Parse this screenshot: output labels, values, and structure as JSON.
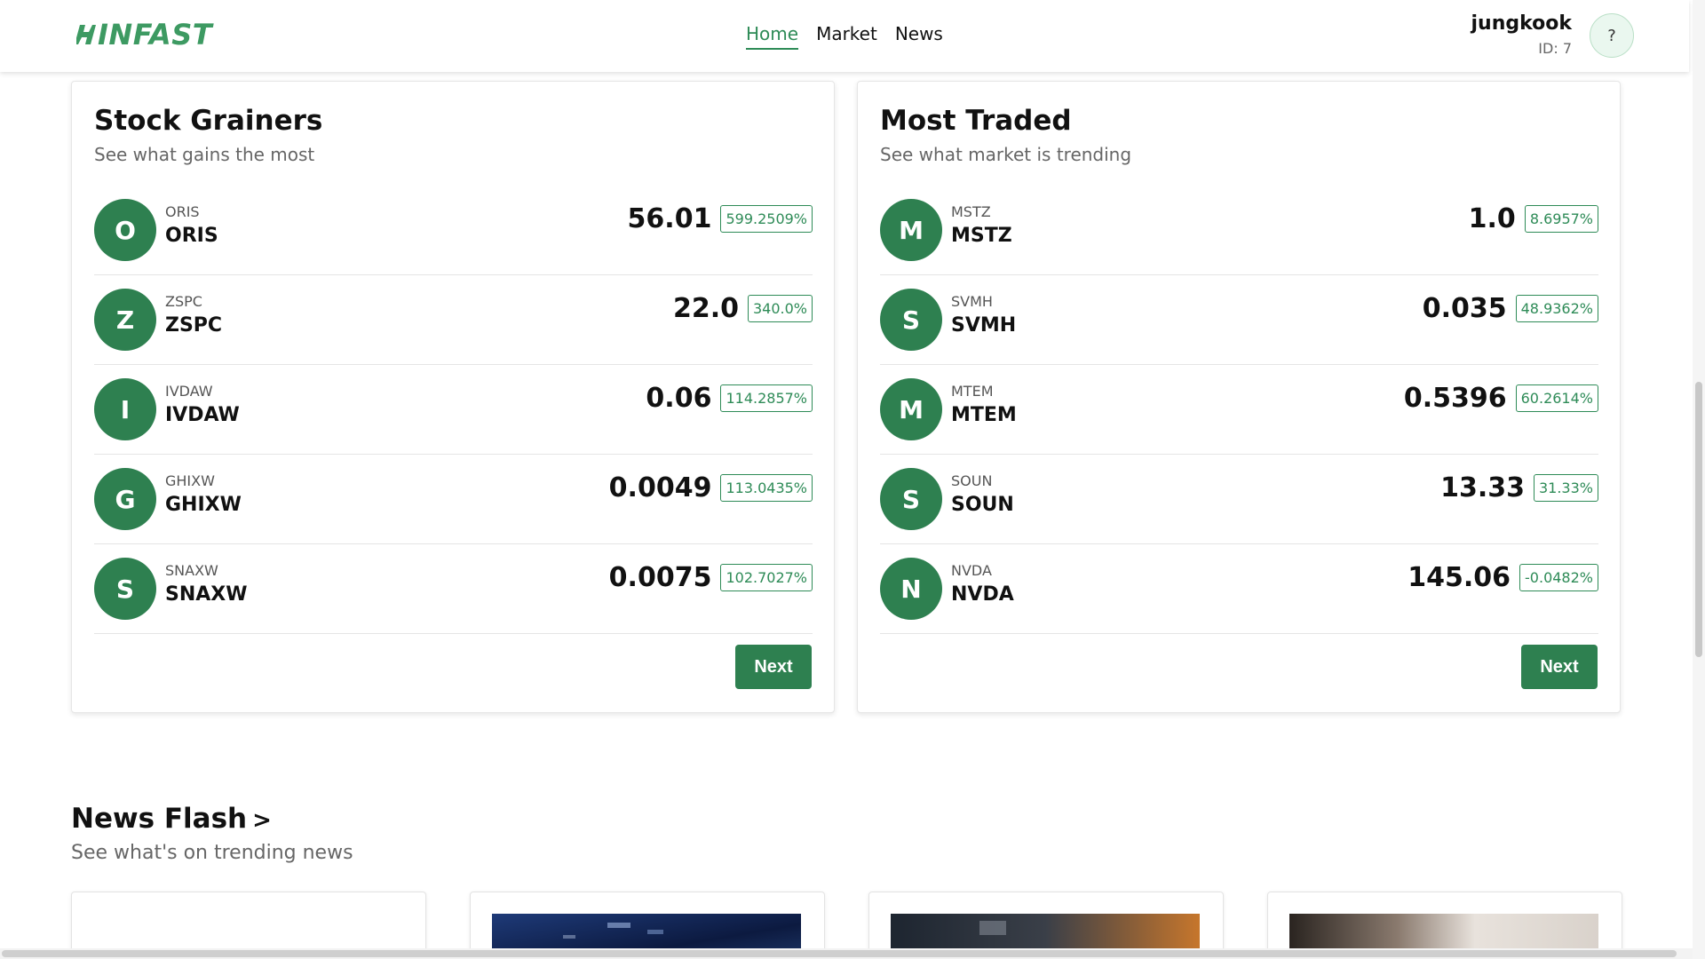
{
  "brand": {
    "name": "INFAST",
    "accent": "#2e8b57",
    "avatar_color": "#2e8050"
  },
  "nav": {
    "items": [
      {
        "label": "Home",
        "active": true
      },
      {
        "label": "Market",
        "active": false
      },
      {
        "label": "News",
        "active": false
      }
    ]
  },
  "user": {
    "name": "jungkook",
    "id_label": "ID: 7",
    "help_label": "?"
  },
  "gainers": {
    "title": "Stock Grainers",
    "subtitle": "See what gains the most",
    "next_label": "Next",
    "rows": [
      {
        "letter": "O",
        "symbol_small": "ORIS",
        "symbol": "ORIS",
        "price": "56.01",
        "change": "599.2509%"
      },
      {
        "letter": "Z",
        "symbol_small": "ZSPC",
        "symbol": "ZSPC",
        "price": "22.0",
        "change": "340.0%"
      },
      {
        "letter": "I",
        "symbol_small": "IVDAW",
        "symbol": "IVDAW",
        "price": "0.06",
        "change": "114.2857%"
      },
      {
        "letter": "G",
        "symbol_small": "GHIXW",
        "symbol": "GHIXW",
        "price": "0.0049",
        "change": "113.0435%"
      },
      {
        "letter": "S",
        "symbol_small": "SNAXW",
        "symbol": "SNAXW",
        "price": "0.0075",
        "change": "102.7027%"
      }
    ]
  },
  "traded": {
    "title": "Most Traded",
    "subtitle": "See what market is trending",
    "next_label": "Next",
    "rows": [
      {
        "letter": "M",
        "symbol_small": "MSTZ",
        "symbol": "MSTZ",
        "price": "1.0",
        "change": "8.6957%"
      },
      {
        "letter": "S",
        "symbol_small": "SVMH",
        "symbol": "SVMH",
        "price": "0.035",
        "change": "48.9362%"
      },
      {
        "letter": "M",
        "symbol_small": "MTEM",
        "symbol": "MTEM",
        "price": "0.5396",
        "change": "60.2614%"
      },
      {
        "letter": "S",
        "symbol_small": "SOUN",
        "symbol": "SOUN",
        "price": "13.33",
        "change": "31.33%"
      },
      {
        "letter": "N",
        "symbol_small": "NVDA",
        "symbol": "NVDA",
        "price": "145.06",
        "change": "-0.0482%"
      }
    ]
  },
  "news": {
    "title": "News Flash",
    "chevron": ">",
    "subtitle": "See what's on trending news"
  }
}
